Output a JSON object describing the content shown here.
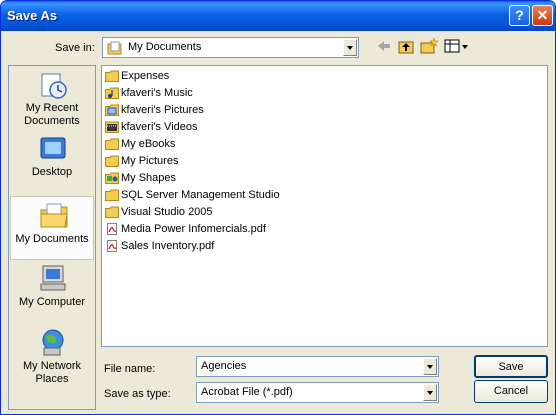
{
  "window": {
    "title": "Save As"
  },
  "toolbar": {
    "save_in_label": "Save in:",
    "save_in_value": "My Documents"
  },
  "places": [
    {
      "label": "My Recent Documents",
      "icon": "recent-documents-icon"
    },
    {
      "label": "Desktop",
      "icon": "desktop-icon"
    },
    {
      "label": "My Documents",
      "icon": "my-documents-icon"
    },
    {
      "label": "My Computer",
      "icon": "my-computer-icon"
    },
    {
      "label": "My Network Places",
      "icon": "network-places-icon"
    }
  ],
  "files": [
    {
      "name": "Expenses",
      "type": "folder"
    },
    {
      "name": "kfaveri's Music",
      "type": "music-folder"
    },
    {
      "name": "kfaveri's Pictures",
      "type": "pictures-folder"
    },
    {
      "name": "kfaveri's Videos",
      "type": "videos-folder"
    },
    {
      "name": "My eBooks",
      "type": "folder"
    },
    {
      "name": "My Pictures",
      "type": "folder"
    },
    {
      "name": "My Shapes",
      "type": "shapes-folder"
    },
    {
      "name": "SQL Server Management Studio",
      "type": "folder"
    },
    {
      "name": "Visual Studio 2005",
      "type": "folder"
    },
    {
      "name": "Media Power Infomercials.pdf",
      "type": "pdf"
    },
    {
      "name": "Sales Inventory.pdf",
      "type": "pdf"
    }
  ],
  "form": {
    "file_name_label": "File name:",
    "file_name_value": "Agencies",
    "save_as_type_label": "Save as type:",
    "save_as_type_value": "Acrobat File (*.pdf)"
  },
  "buttons": {
    "save": "Save",
    "cancel": "Cancel"
  },
  "colors": {
    "titlebar": "#0554d8",
    "dialog": "#ece9d8",
    "folder": "#f3cc52",
    "pdf": "#d1201f"
  }
}
